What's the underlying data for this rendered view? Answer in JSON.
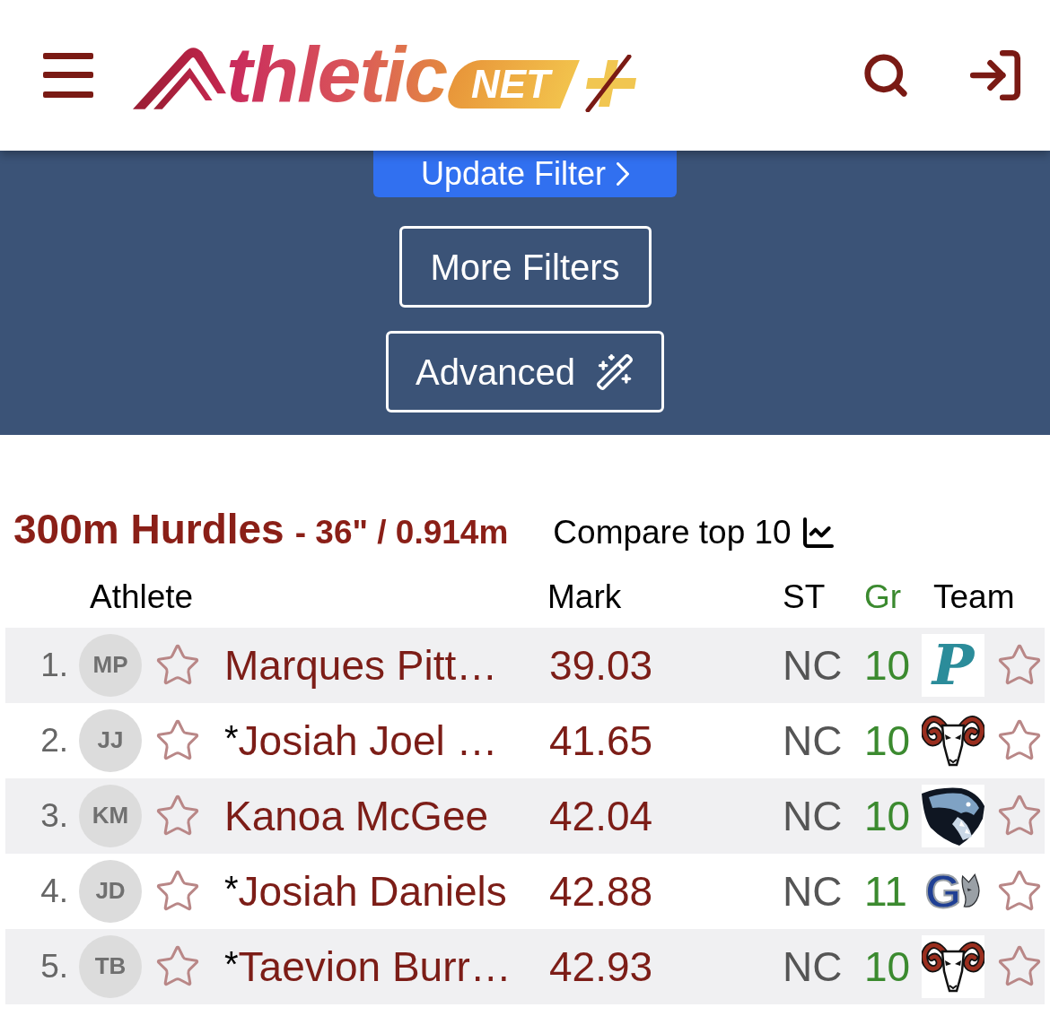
{
  "header": {
    "logo": {
      "text": "thletic",
      "badge": "NET"
    }
  },
  "filters": {
    "update_button": "Update Filter",
    "more_button": "More Filters",
    "advanced_button": "Advanced"
  },
  "event": {
    "title": "300m Hurdles",
    "spec": "- 36\" / 0.914m",
    "compare_link": "Compare top 10"
  },
  "table": {
    "columns": [
      {
        "label": "Athlete"
      },
      {
        "label": "Mark"
      },
      {
        "label": "ST"
      },
      {
        "label": "Gr",
        "color": "#3b8a2f"
      },
      {
        "label": "Team"
      }
    ],
    "rows": [
      {
        "rank": "1.",
        "initials": "MP",
        "athlete_starred": false,
        "name": "Marques Pitt…",
        "mark": "39.03",
        "state": "NC",
        "grade": "10",
        "team_logo": {
          "kind": "letter",
          "letter": "P",
          "color": "#2b8c9a"
        },
        "team_starred": false
      },
      {
        "rank": "2.",
        "initials": "JJ",
        "athlete_starred": false,
        "prefix": "*",
        "name": "Josiah Joel …",
        "mark": "41.65",
        "state": "NC",
        "grade": "10",
        "team_logo": {
          "kind": "ram"
        },
        "team_starred": false
      },
      {
        "rank": "3.",
        "initials": "KM",
        "athlete_starred": false,
        "name": "Kanoa McGee",
        "mark": "42.04",
        "state": "NC",
        "grade": "10",
        "team_logo": {
          "kind": "panther"
        },
        "team_starred": false
      },
      {
        "rank": "4.",
        "initials": "JD",
        "athlete_starred": false,
        "prefix": "*",
        "name": "Josiah Daniels",
        "mark": "42.88",
        "state": "NC",
        "grade": "11",
        "team_logo": {
          "kind": "letter_cat",
          "letter": "G",
          "color": "#1f3f94"
        },
        "team_starred": false
      },
      {
        "rank": "5.",
        "initials": "TB",
        "athlete_starred": false,
        "prefix": "*",
        "name": "Taevion Burr…",
        "mark": "42.93",
        "state": "NC",
        "grade": "10",
        "team_logo": {
          "kind": "ram"
        },
        "team_starred": false
      }
    ]
  }
}
